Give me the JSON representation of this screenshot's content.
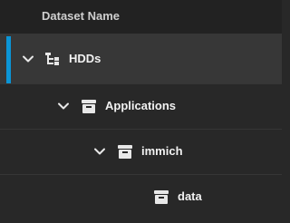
{
  "header": {
    "column_label": "Dataset Name"
  },
  "rows": [
    {
      "label": "HDDs",
      "level": 0,
      "expanded": true,
      "selected": true,
      "icon": "pool-tree-icon"
    },
    {
      "label": "Applications",
      "level": 1,
      "expanded": true,
      "selected": false,
      "icon": "dataset-icon"
    },
    {
      "label": "immich",
      "level": 2,
      "expanded": true,
      "selected": false,
      "icon": "dataset-icon"
    },
    {
      "label": "data",
      "level": 3,
      "expanded": false,
      "selected": false,
      "icon": "dataset-icon"
    }
  ],
  "colors": {
    "accent": "#0b95d6",
    "background": "#282828",
    "selected_row": "#373737",
    "text": "#f2f2f2"
  }
}
